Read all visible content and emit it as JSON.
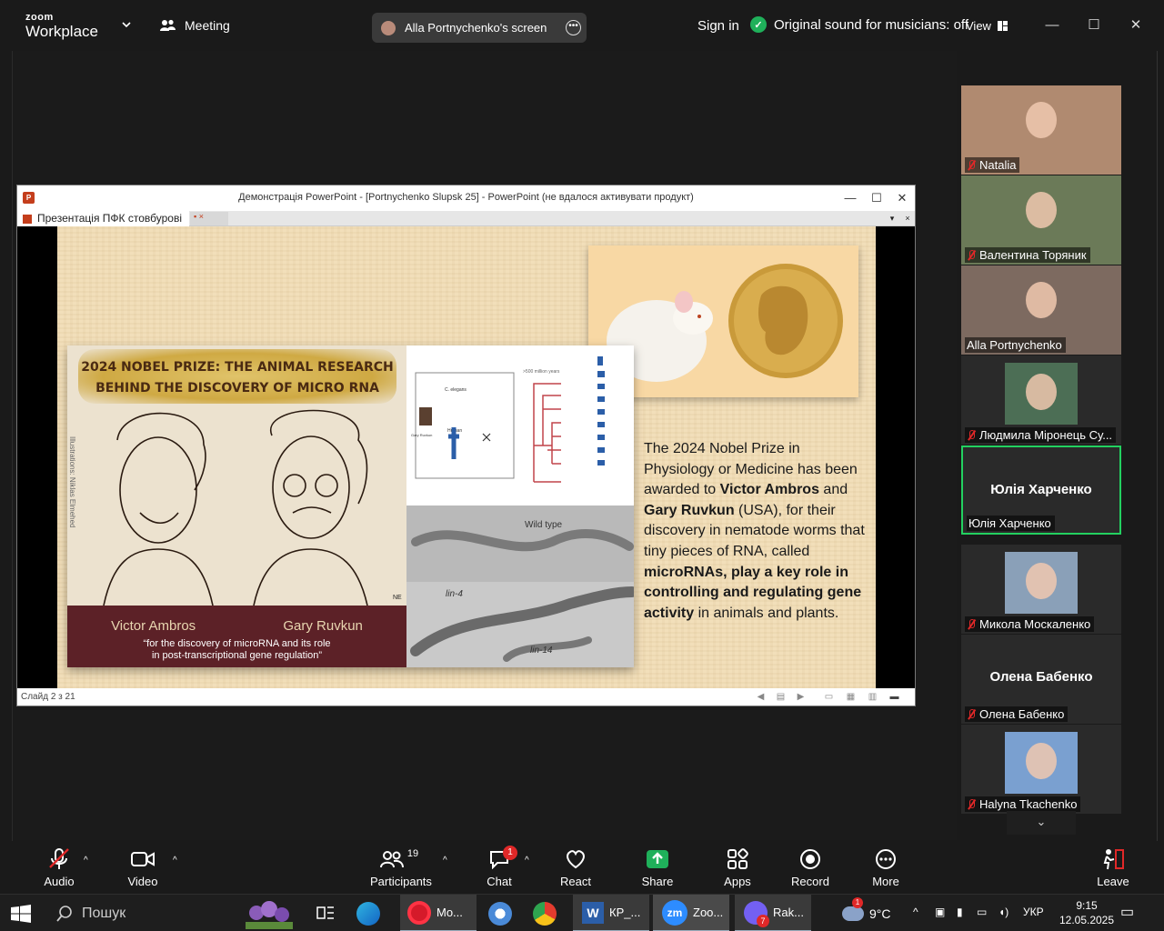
{
  "app": {
    "logo_top": "zoom",
    "logo_bottom": "Workplace",
    "meeting": "Meeting",
    "sharing": "Alla Portnychenko's screen",
    "sign_in": "Sign in",
    "original_sound": "Original sound for musicians: off",
    "view": "View"
  },
  "ppt": {
    "title": "Демонстрація PowerPoint - [Portnychenko Slupsk 25] - PowerPoint (не вдалося активувати продукт)",
    "tab1": "Презентація ПФК стовбурові",
    "status": "Слайд 2 з 21"
  },
  "slide": {
    "headline1": "2024 NOBEL PRIZE: THE ANIMAL RESEARCH",
    "headline2": "BEHIND THE DISCOVERY OF MICRO RNA",
    "name1": "Victor Ambros",
    "name2": "Gary Ruvkun",
    "quote1": "“for the discovery of microRNA and its role",
    "quote2": "in post-transcriptional gene regulation”",
    "illustrations": "Illustrations: Niklas Elmehed",
    "sig": "NE",
    "diagram_top": ">500 million years",
    "diagram_celegans": "C. elegans",
    "diagram_human": "Human",
    "diagram_gary": "Gary Ruvkun",
    "worm1": "Wild type",
    "worm2": "lin-4",
    "worm3": "lin-14",
    "body": [
      {
        "t": "The 2024 Nobel Prize in Physiology or Medicine has been awarded to ",
        "b": false
      },
      {
        "t": "Victor Ambros",
        "b": true
      },
      {
        "t": " and ",
        "b": false
      },
      {
        "t": "Gary Ruvkun",
        "b": true
      },
      {
        "t": " (USA), for their discovery in nematode worms that tiny pieces of RNA, called ",
        "b": false
      },
      {
        "t": "microRNAs, play a key role in controlling and regulating gene activity",
        "b": true
      },
      {
        "t": " in animals and plants.",
        "b": false
      }
    ]
  },
  "participants": [
    {
      "name": "Natalia",
      "muted": true,
      "video": true,
      "color": "#b08a70"
    },
    {
      "name": "Валентина Торяник",
      "muted": true,
      "video": true,
      "color": "#6b7a58"
    },
    {
      "name": "Alla Portnychenko",
      "muted": false,
      "video": true,
      "color": "#7d6a60"
    },
    {
      "name": "Людмила Міронець Су...",
      "muted": true,
      "video": true,
      "color": "#4c6e55"
    },
    {
      "name": "Юлія Харченко",
      "muted": false,
      "video": false,
      "big": "Юлія Харченко",
      "active": true
    },
    {
      "name": "Микола Москаленко",
      "muted": true,
      "video": true,
      "color": "#8aa0b8"
    },
    {
      "name": "Олена Бабенко",
      "muted": true,
      "video": false,
      "big": "Олена Бабенко"
    },
    {
      "name": "Halyna Tkachenko",
      "muted": true,
      "video": true,
      "color": "#7aa0d0"
    }
  ],
  "toolbar": {
    "audio": "Audio",
    "video": "Video",
    "participants": "Participants",
    "participants_count": "19",
    "chat": "Chat",
    "chat_badge": "1",
    "react": "React",
    "share": "Share",
    "apps": "Apps",
    "record": "Record",
    "more": "More",
    "leave": "Leave"
  },
  "taskbar": {
    "search": "Пошук",
    "opera": "Mo...",
    "word": "КР_...",
    "zoom": "Zoo...",
    "viber": "Rak...",
    "viber_badge": "7",
    "weather": "9°C",
    "weather_badge": "1",
    "lang": "УКР",
    "time": "9:15",
    "date": "12.05.2025"
  }
}
